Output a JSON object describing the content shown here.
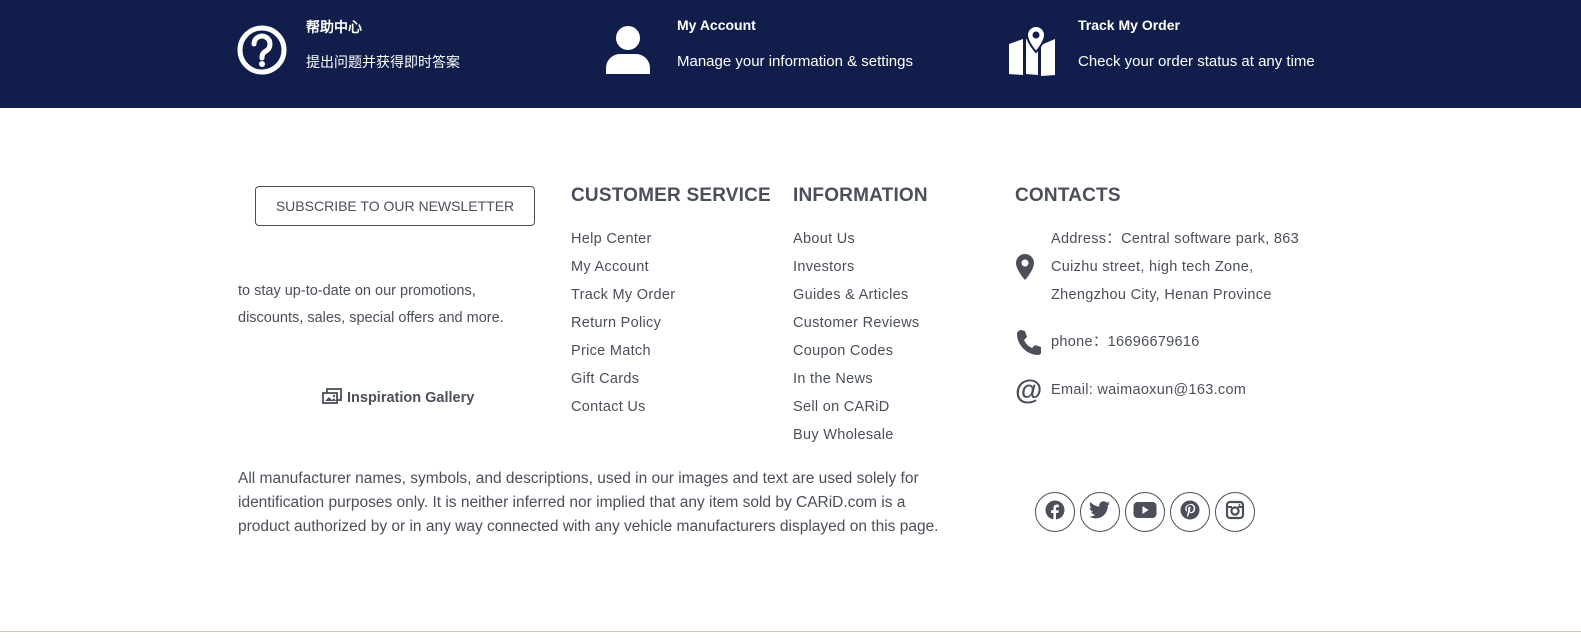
{
  "topbar": {
    "items": [
      {
        "icon": "question-circle-icon",
        "title": "帮助中心",
        "subtitle": "提出问题并获得即时答案"
      },
      {
        "icon": "user-icon",
        "title": "My Account",
        "subtitle": "Manage your information & settings"
      },
      {
        "icon": "map-pin-icon",
        "title": "Track My Order",
        "subtitle": "Check your order status at any time"
      }
    ]
  },
  "newsletter": {
    "button_label": "SUBSCRIBE TO OUR NEWSLETTER",
    "description": "to stay up-to-date on our promotions, discounts, sales, special offers and more."
  },
  "gallery": {
    "icon": "gallery-icon",
    "label": "Inspiration Gallery"
  },
  "customer_service": {
    "heading": "CUSTOMER SERVICE",
    "links": [
      "Help Center",
      "My Account",
      "Track My Order",
      "Return Policy",
      "Price Match",
      "Gift Cards",
      "Contact Us"
    ]
  },
  "information": {
    "heading": "INFORMATION",
    "links": [
      "About Us",
      "Investors",
      "Guides & Articles",
      "Customer Reviews",
      "Coupon Codes",
      "In the News",
      "Sell on CARiD",
      "Buy Wholesale"
    ]
  },
  "contacts": {
    "heading": "CONTACTS",
    "address_lines": [
      "Address：Central software park, 863",
      "Cuizhu street, high tech Zone,",
      "Zhengzhou City, Henan Province"
    ],
    "phone": "phone：16696679616",
    "email": "Email: waimaoxun@163.com"
  },
  "disclaimer": "All manufacturer names, symbols, and descriptions, used in our images and text are used solely for identification purposes only. It is neither inferred nor implied that any item sold by CARiD.com is a product authorized by or in any way connected with any vehicle manufacturers displayed on this page.",
  "social": [
    "facebook-icon",
    "twitter-icon",
    "youtube-icon",
    "pinterest-icon",
    "instagram-icon"
  ],
  "colors": {
    "topbar_bg": "#111e4b",
    "text": "#4a4f5a",
    "rule": "#d9c7b5"
  }
}
